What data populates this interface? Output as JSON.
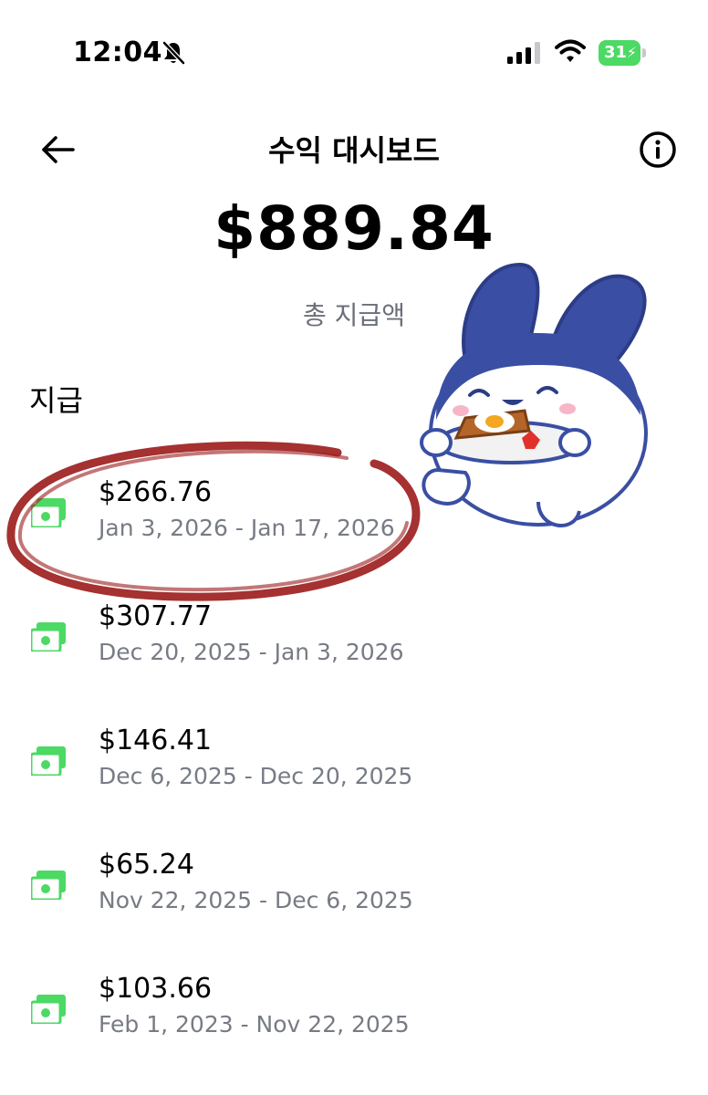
{
  "status": {
    "time": "12:04",
    "battery": "31"
  },
  "header": {
    "title": "수익 대시보드"
  },
  "summary": {
    "total": "$889.84",
    "label": "총 지급액"
  },
  "section_title": "지급",
  "payouts": [
    {
      "amount": "$266.76",
      "dates": "Jan 3, 2026 - Jan 17, 2026"
    },
    {
      "amount": "$307.77",
      "dates": "Dec 20, 2025 - Jan 3, 2026"
    },
    {
      "amount": "$146.41",
      "dates": "Dec 6, 2025 - Dec 20, 2025"
    },
    {
      "amount": "$65.24",
      "dates": "Nov 22, 2025 - Dec 6, 2025"
    },
    {
      "amount": "$103.66",
      "dates": "Feb 1, 2023 - Nov 22, 2025"
    }
  ],
  "colors": {
    "money_icon": "#4cd964",
    "annotation": "#9b1b1b",
    "sticker_blue": "#3a4fa3"
  },
  "icons": [
    "bell-slash-icon",
    "signal-icon",
    "wifi-icon",
    "battery-icon",
    "back-arrow-icon",
    "info-icon",
    "money-icon"
  ]
}
